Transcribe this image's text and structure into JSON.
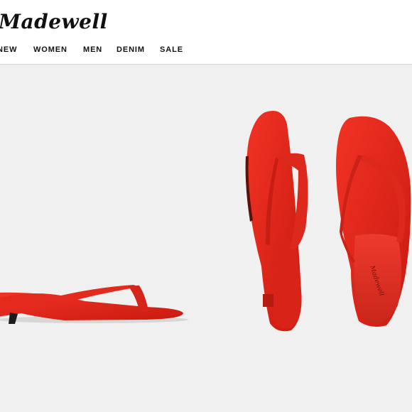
{
  "brand": {
    "logo_text": "Madewell"
  },
  "nav": {
    "items": [
      {
        "id": "new",
        "label": "NEW"
      },
      {
        "id": "women",
        "label": "WOMEN"
      },
      {
        "id": "men",
        "label": "MEN"
      },
      {
        "id": "denim",
        "label": "DENIM"
      },
      {
        "id": "sale",
        "label": "SALE"
      }
    ]
  },
  "product": {
    "sole_logo_text": "Madewell",
    "color": "#e0241a"
  }
}
